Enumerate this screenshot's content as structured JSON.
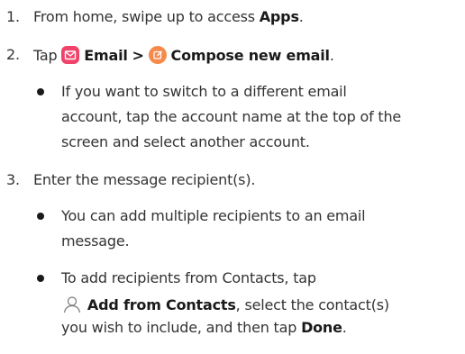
{
  "steps": [
    {
      "number": "1.",
      "text": "From home, swipe up to access ",
      "bold": "Apps",
      "end": "."
    },
    {
      "number": "2.",
      "tap": "Tap",
      "email_label": "Email",
      "separator": ">",
      "compose_label": "Compose new email",
      "end": ".",
      "bullets": [
        {
          "lines": [
            "If you want to switch to a different email",
            "account, tap the account name at the top of the",
            "screen and select another account."
          ]
        }
      ]
    },
    {
      "number": "3.",
      "text": "Enter the message recipient(s).",
      "bullets": [
        {
          "lines": [
            "You can add multiple recipients to an email",
            "message."
          ]
        },
        {
          "line1": "To add recipients from Contacts, tap",
          "add_contacts_label": "Add from Contacts",
          "line2_rest": ", select the contact(s)",
          "line3_start": "you wish to include, and then tap ",
          "done_label": "Done",
          "line3_end": "."
        }
      ]
    }
  ],
  "icons": {
    "email": "email-app-icon",
    "compose": "compose-icon",
    "contact": "contact-person-icon"
  },
  "colors": {
    "email_icon": "#f0436a",
    "compose_icon": "#f58a4b"
  }
}
